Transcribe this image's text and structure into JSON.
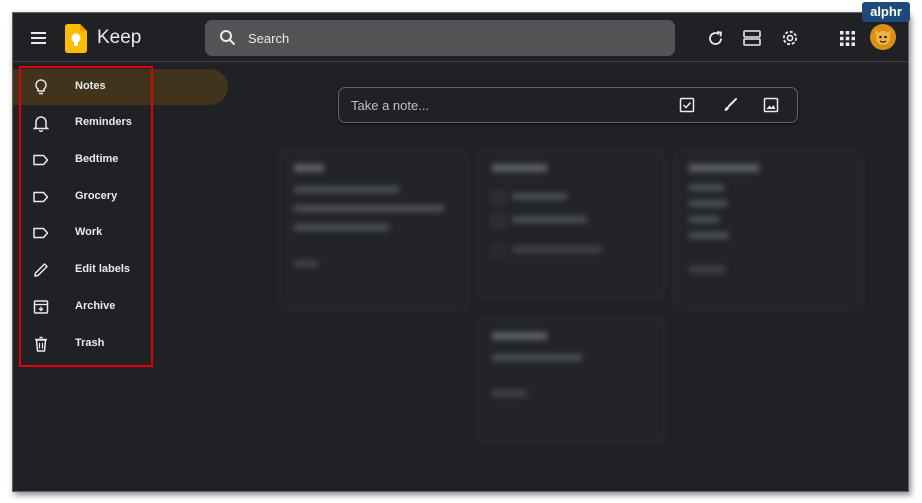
{
  "app": {
    "name": "Keep"
  },
  "search": {
    "placeholder": "Search"
  },
  "sidebar": {
    "items": [
      {
        "label": "Notes"
      },
      {
        "label": "Reminders"
      },
      {
        "label": "Bedtime"
      },
      {
        "label": "Grocery"
      },
      {
        "label": "Work"
      },
      {
        "label": "Edit labels"
      },
      {
        "label": "Archive"
      },
      {
        "label": "Trash"
      }
    ]
  },
  "take_note": {
    "placeholder": "Take a note..."
  },
  "watermark": {
    "text": "alphr"
  },
  "colors": {
    "background": "#202124",
    "search_bg": "#525355",
    "active_nav": "#41331c",
    "highlight_border": "#e30000",
    "logo_yellow": "#fbbc04"
  },
  "icons": {
    "menu": "hamburger-icon",
    "logo": "keep-bulb-logo",
    "search": "search-icon",
    "refresh": "refresh-icon",
    "list_view": "list-view-icon",
    "settings": "gear-icon",
    "apps": "apps-grid-icon",
    "avatar": "avatar",
    "notes": "lightbulb-icon",
    "reminders": "bell-icon",
    "label": "label-icon",
    "edit_labels": "pencil-icon",
    "archive": "archive-icon",
    "trash": "trash-icon",
    "checkbox": "checkbox-icon",
    "brush": "brush-icon",
    "image": "image-icon"
  }
}
